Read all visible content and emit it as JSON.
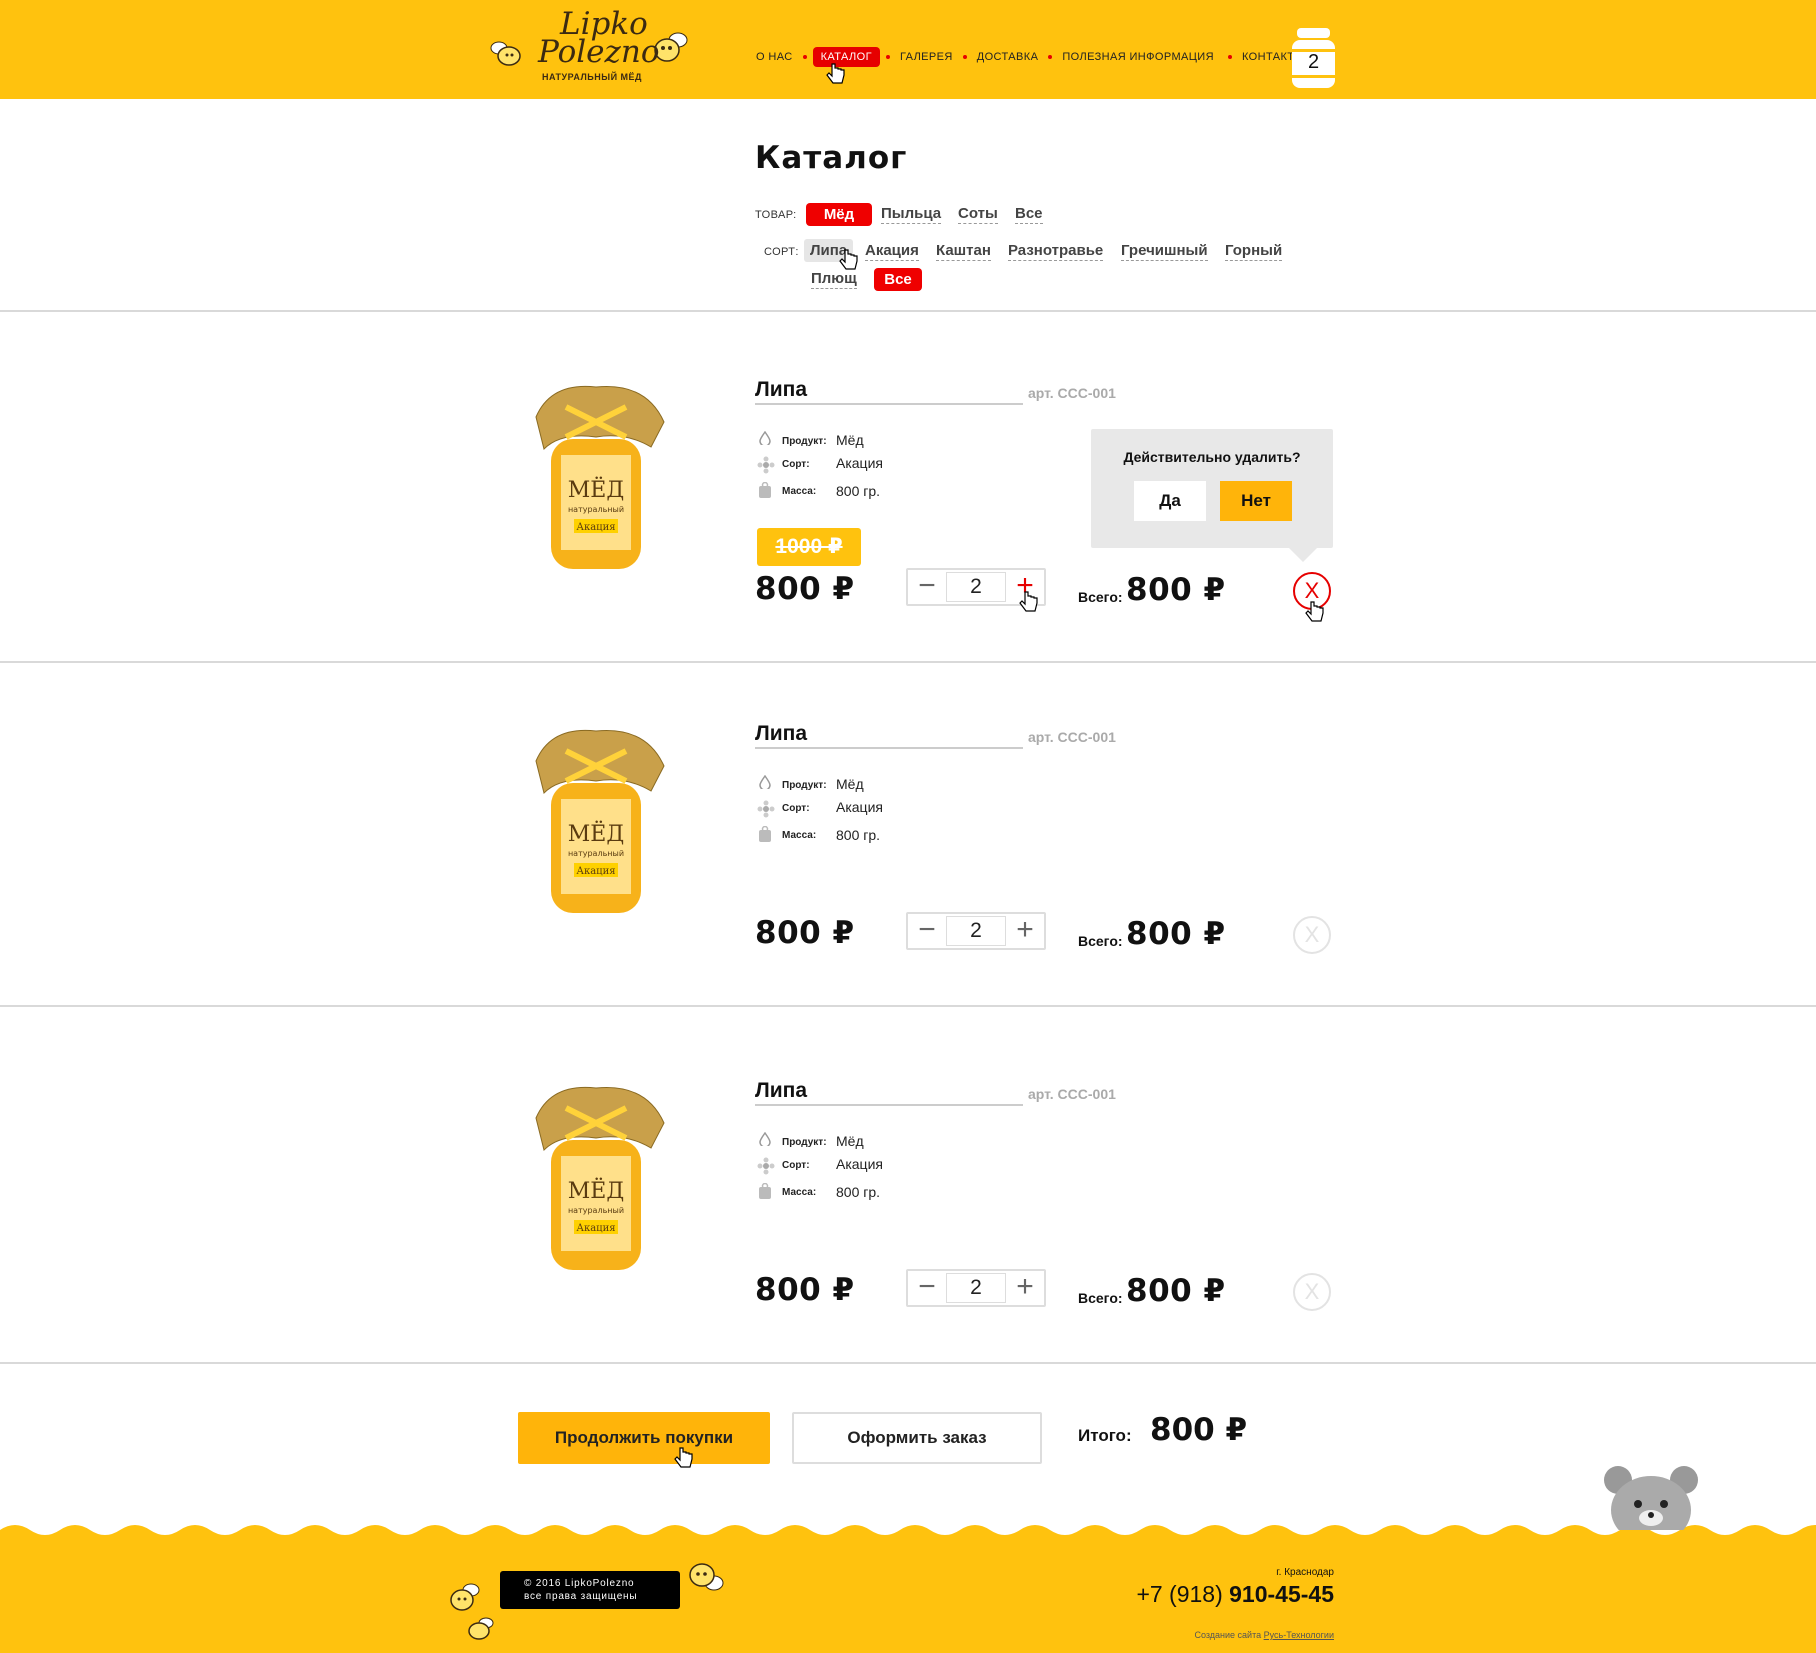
{
  "header": {
    "logo_line1": "Lipko",
    "logo_line2": "Polezno",
    "logo_sub": "НАТУРАЛЬНЫЙ МЁД",
    "nav": [
      "О НАС",
      "КАТАЛОГ",
      "ГАЛЕРЕЯ",
      "ДОСТАВКА",
      "ПОЛЕЗНАЯ ИНФОРМАЦИЯ",
      "КОНТАКТЫ"
    ],
    "cart_count": "2"
  },
  "page_title": "Каталог",
  "filters": {
    "product_label": "ТОВАР:",
    "product_options": [
      "Мёд",
      "Пыльца",
      "Соты",
      "Все"
    ],
    "sort_label": "СОРТ:",
    "sort_options": [
      "Липа",
      "Акация",
      "Каштан",
      "Разнотравье",
      "Гречишный",
      "Горный",
      "Плющ",
      "Все"
    ]
  },
  "products": [
    {
      "name": "Липа",
      "art": "арт. ССС-001",
      "product_key": "Продукт:",
      "product_val": "Мёд",
      "sort_key": "Сорт:",
      "sort_val": "Акация",
      "mass_key": "Масса:",
      "mass_val": "800 гр.",
      "old_price": "1000 ₽",
      "price": "800 ₽",
      "qty": "2",
      "total_label": "Всего:",
      "total": "800 ₽",
      "delete": "X"
    },
    {
      "name": "Липа",
      "art": "арт. ССС-001",
      "product_key": "Продукт:",
      "product_val": "Мёд",
      "sort_key": "Сорт:",
      "sort_val": "Акация",
      "mass_key": "Масса:",
      "mass_val": "800 гр.",
      "price": "800 ₽",
      "qty": "2",
      "total_label": "Всего:",
      "total": "800 ₽",
      "delete": "X"
    },
    {
      "name": "Липа",
      "art": "арт. ССС-001",
      "product_key": "Продукт:",
      "product_val": "Мёд",
      "sort_key": "Сорт:",
      "sort_val": "Акация",
      "mass_key": "Масса:",
      "mass_val": "800 гр.",
      "price": "800 ₽",
      "qty": "2",
      "total_label": "Всего:",
      "total": "800 ₽",
      "delete": "X"
    }
  ],
  "delete_popup": {
    "question": "Действительно удалить?",
    "yes": "Да",
    "no": "Нет"
  },
  "jar_label": {
    "title": "МЁД",
    "sub": "натуральный",
    "sort": "Акация"
  },
  "stepper": {
    "minus": "−",
    "plus": "+"
  },
  "actions": {
    "continue": "Продолжить покупки",
    "order": "Оформить заказ",
    "total_label": "Итого:",
    "total": "800 ₽"
  },
  "footer": {
    "copyright_line1": "© 2016 LipkoPolezno",
    "copyright_line2": "все права защищены",
    "city": "г. Краснодар",
    "phone_code": "+7 (918)",
    "phone_num": "910-45-45",
    "credit_prefix": "Создание сайта",
    "credit_link": "Русь-Технологии"
  },
  "colors": {
    "accent": "#ffc20e",
    "button_yellow": "#ffb40a",
    "active_red": "#e60000",
    "divider": "#d9d9d9"
  }
}
